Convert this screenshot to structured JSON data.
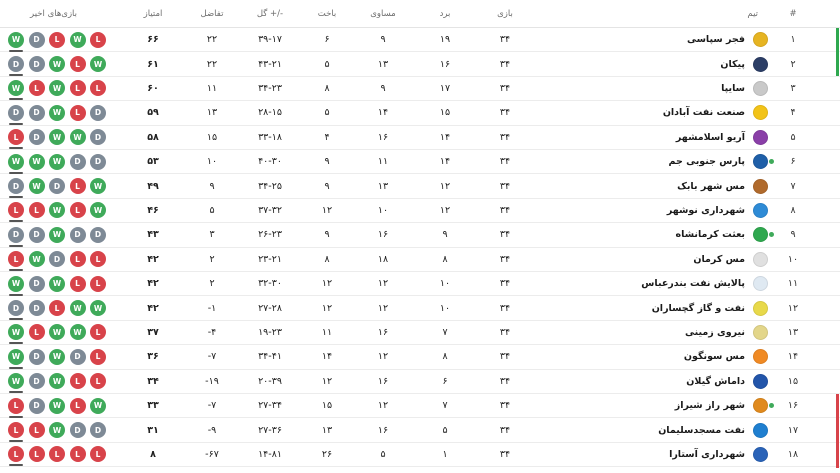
{
  "header": {
    "rank": "#",
    "team": "تیم",
    "played": "بازی",
    "won": "برد",
    "drawn": "مساوی",
    "lost": "باخت",
    "goals": "گل +/-",
    "diff": "تفاضل",
    "points": "امتیاز",
    "form": "بازی‌های اخیر"
  },
  "colors": {
    "win": "#3faa5a",
    "loss": "#d8434a",
    "draw": "#7e8a96",
    "promotion": "#2fa84f",
    "relegation": "#d8434a"
  },
  "rows": [
    {
      "rank": "۱",
      "team": "فجر سپاسی",
      "played": "۳۴",
      "won": "۱۹",
      "drawn": "۹",
      "lost": "۶",
      "goals": "۳۹-۱۷",
      "diff": "۲۲",
      "points": "۶۶",
      "form": [
        "W",
        "D",
        "L",
        "W",
        "L"
      ],
      "logo": "#e6b422",
      "marker": ""
    },
    {
      "rank": "۲",
      "team": "پیکان",
      "played": "۳۴",
      "won": "۱۶",
      "drawn": "۱۳",
      "lost": "۵",
      "goals": "۴۳-۲۱",
      "diff": "۲۲",
      "points": "۶۱",
      "form": [
        "D",
        "D",
        "W",
        "L",
        "W"
      ],
      "logo": "#2c3e66",
      "marker": ""
    },
    {
      "rank": "۳",
      "team": "سایپا",
      "played": "۳۴",
      "won": "۱۷",
      "drawn": "۹",
      "lost": "۸",
      "goals": "۳۴-۲۳",
      "diff": "۱۱",
      "points": "۶۰",
      "form": [
        "W",
        "L",
        "W",
        "L",
        "L"
      ],
      "logo": "#c9c9c9",
      "marker": ""
    },
    {
      "rank": "۴",
      "team": "صنعت نفت آبادان",
      "played": "۳۴",
      "won": "۱۵",
      "drawn": "۱۴",
      "lost": "۵",
      "goals": "۲۸-۱۵",
      "diff": "۱۳",
      "points": "۵۹",
      "form": [
        "D",
        "D",
        "W",
        "L",
        "D"
      ],
      "logo": "#f2c318",
      "marker": ""
    },
    {
      "rank": "۵",
      "team": "آریو اسلامشهر",
      "played": "۳۴",
      "won": "۱۴",
      "drawn": "۱۶",
      "lost": "۴",
      "goals": "۳۳-۱۸",
      "diff": "۱۵",
      "points": "۵۸",
      "form": [
        "L",
        "D",
        "W",
        "W",
        "D"
      ],
      "logo": "#8a3fa8",
      "marker": ""
    },
    {
      "rank": "۶",
      "team": "پارس جنوبی جم",
      "played": "۳۴",
      "won": "۱۴",
      "drawn": "۱۱",
      "lost": "۹",
      "goals": "۴۰-۳۰",
      "diff": "۱۰",
      "points": "۵۳",
      "form": [
        "W",
        "W",
        "W",
        "D",
        "D"
      ],
      "logo": "#1f5fa8",
      "marker": "#3faa5a"
    },
    {
      "rank": "۷",
      "team": "مس شهر بابک",
      "played": "۳۴",
      "won": "۱۲",
      "drawn": "۱۳",
      "lost": "۹",
      "goals": "۳۴-۲۵",
      "diff": "۹",
      "points": "۴۹",
      "form": [
        "D",
        "W",
        "D",
        "L",
        "W"
      ],
      "logo": "#b06a2c",
      "marker": ""
    },
    {
      "rank": "۸",
      "team": "شهرداری نوشهر",
      "played": "۳۴",
      "won": "۱۲",
      "drawn": "۱۰",
      "lost": "۱۲",
      "goals": "۳۷-۳۲",
      "diff": "۵",
      "points": "۴۶",
      "form": [
        "L",
        "L",
        "W",
        "L",
        "W"
      ],
      "logo": "#2e8bd6",
      "marker": ""
    },
    {
      "rank": "۹",
      "team": "بعثت کرمانشاه",
      "played": "۳۴",
      "won": "۹",
      "drawn": "۱۶",
      "lost": "۹",
      "goals": "۲۶-۲۳",
      "diff": "۳",
      "points": "۴۳",
      "form": [
        "D",
        "D",
        "W",
        "D",
        "D"
      ],
      "logo": "#2fa84f",
      "marker": "#3faa5a"
    },
    {
      "rank": "۱۰",
      "team": "مس کرمان",
      "played": "۳۴",
      "won": "۸",
      "drawn": "۱۸",
      "lost": "۸",
      "goals": "۲۳-۲۱",
      "diff": "۲",
      "points": "۴۲",
      "form": [
        "L",
        "W",
        "D",
        "L",
        "L"
      ],
      "logo": "#e0e0e0",
      "marker": ""
    },
    {
      "rank": "۱۱",
      "team": "پالایش نفت بندرعباس",
      "played": "۳۴",
      "won": "۱۰",
      "drawn": "۱۲",
      "lost": "۱۲",
      "goals": "۳۲-۳۰",
      "diff": "۲",
      "points": "۴۲",
      "form": [
        "W",
        "D",
        "W",
        "L",
        "L"
      ],
      "logo": "#dfe9f2",
      "marker": ""
    },
    {
      "rank": "۱۲",
      "team": "نفت و گاز گچساران",
      "played": "۳۴",
      "won": "۱۰",
      "drawn": "۱۲",
      "lost": "۱۲",
      "goals": "۲۷-۲۸",
      "diff": "-۱",
      "points": "۴۲",
      "form": [
        "D",
        "D",
        "L",
        "W",
        "W"
      ],
      "logo": "#e8d94a",
      "marker": ""
    },
    {
      "rank": "۱۳",
      "team": "نیروی زمینی",
      "played": "۳۴",
      "won": "۷",
      "drawn": "۱۶",
      "lost": "۱۱",
      "goals": "۱۹-۲۳",
      "diff": "-۴",
      "points": "۳۷",
      "form": [
        "W",
        "L",
        "W",
        "W",
        "L"
      ],
      "logo": "#e3d68a",
      "marker": ""
    },
    {
      "rank": "۱۴",
      "team": "مس سونگون",
      "played": "۳۴",
      "won": "۸",
      "drawn": "۱۲",
      "lost": "۱۴",
      "goals": "۳۴-۴۱",
      "diff": "-۷",
      "points": "۳۶",
      "form": [
        "W",
        "D",
        "W",
        "D",
        "L"
      ],
      "logo": "#f08a24",
      "marker": ""
    },
    {
      "rank": "۱۵",
      "team": "داماش گیلان",
      "played": "۳۴",
      "won": "۶",
      "drawn": "۱۶",
      "lost": "۱۲",
      "goals": "۲۰-۳۹",
      "diff": "-۱۹",
      "points": "۳۴",
      "form": [
        "W",
        "D",
        "W",
        "L",
        "L"
      ],
      "logo": "#2255aa",
      "marker": ""
    },
    {
      "rank": "۱۶",
      "team": "شهر راز شیراز",
      "played": "۳۴",
      "won": "۷",
      "drawn": "۱۲",
      "lost": "۱۵",
      "goals": "۲۷-۳۴",
      "diff": "-۷",
      "points": "۳۳",
      "form": [
        "L",
        "D",
        "W",
        "L",
        "W"
      ],
      "logo": "#e08a1e",
      "marker": "#3faa5a"
    },
    {
      "rank": "۱۷",
      "team": "نفت مسجدسلیمان",
      "played": "۳۴",
      "won": "۵",
      "drawn": "۱۶",
      "lost": "۱۳",
      "goals": "۲۷-۳۶",
      "diff": "-۹",
      "points": "۳۱",
      "form": [
        "L",
        "L",
        "W",
        "D",
        "D"
      ],
      "logo": "#1f7fd0",
      "marker": ""
    },
    {
      "rank": "۱۸",
      "team": "شهرداری آستارا",
      "played": "۳۴",
      "won": "۱",
      "drawn": "۵",
      "lost": "۲۶",
      "goals": "۱۴-۸۱",
      "diff": "-۶۷",
      "points": "۸",
      "form": [
        "L",
        "L",
        "L",
        "L",
        "L"
      ],
      "logo": "#2a63b8",
      "marker": ""
    }
  ]
}
